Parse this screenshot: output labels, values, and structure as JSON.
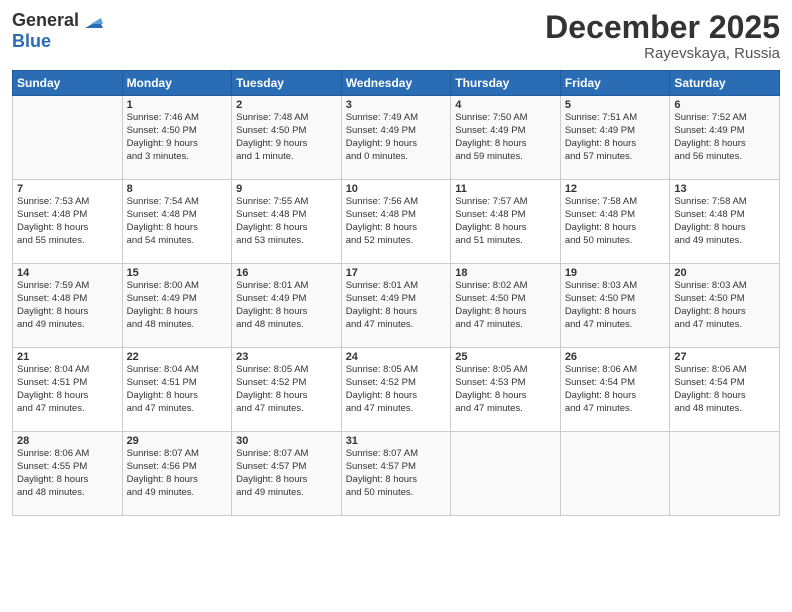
{
  "logo": {
    "general": "General",
    "blue": "Blue"
  },
  "title": "December 2025",
  "location": "Rayevskaya, Russia",
  "weekdays": [
    "Sunday",
    "Monday",
    "Tuesday",
    "Wednesday",
    "Thursday",
    "Friday",
    "Saturday"
  ],
  "weeks": [
    [
      {
        "day": "",
        "lines": []
      },
      {
        "day": "1",
        "lines": [
          "Sunrise: 7:46 AM",
          "Sunset: 4:50 PM",
          "Daylight: 9 hours",
          "and 3 minutes."
        ]
      },
      {
        "day": "2",
        "lines": [
          "Sunrise: 7:48 AM",
          "Sunset: 4:50 PM",
          "Daylight: 9 hours",
          "and 1 minute."
        ]
      },
      {
        "day": "3",
        "lines": [
          "Sunrise: 7:49 AM",
          "Sunset: 4:49 PM",
          "Daylight: 9 hours",
          "and 0 minutes."
        ]
      },
      {
        "day": "4",
        "lines": [
          "Sunrise: 7:50 AM",
          "Sunset: 4:49 PM",
          "Daylight: 8 hours",
          "and 59 minutes."
        ]
      },
      {
        "day": "5",
        "lines": [
          "Sunrise: 7:51 AM",
          "Sunset: 4:49 PM",
          "Daylight: 8 hours",
          "and 57 minutes."
        ]
      },
      {
        "day": "6",
        "lines": [
          "Sunrise: 7:52 AM",
          "Sunset: 4:49 PM",
          "Daylight: 8 hours",
          "and 56 minutes."
        ]
      }
    ],
    [
      {
        "day": "7",
        "lines": [
          "Sunrise: 7:53 AM",
          "Sunset: 4:48 PM",
          "Daylight: 8 hours",
          "and 55 minutes."
        ]
      },
      {
        "day": "8",
        "lines": [
          "Sunrise: 7:54 AM",
          "Sunset: 4:48 PM",
          "Daylight: 8 hours",
          "and 54 minutes."
        ]
      },
      {
        "day": "9",
        "lines": [
          "Sunrise: 7:55 AM",
          "Sunset: 4:48 PM",
          "Daylight: 8 hours",
          "and 53 minutes."
        ]
      },
      {
        "day": "10",
        "lines": [
          "Sunrise: 7:56 AM",
          "Sunset: 4:48 PM",
          "Daylight: 8 hours",
          "and 52 minutes."
        ]
      },
      {
        "day": "11",
        "lines": [
          "Sunrise: 7:57 AM",
          "Sunset: 4:48 PM",
          "Daylight: 8 hours",
          "and 51 minutes."
        ]
      },
      {
        "day": "12",
        "lines": [
          "Sunrise: 7:58 AM",
          "Sunset: 4:48 PM",
          "Daylight: 8 hours",
          "and 50 minutes."
        ]
      },
      {
        "day": "13",
        "lines": [
          "Sunrise: 7:58 AM",
          "Sunset: 4:48 PM",
          "Daylight: 8 hours",
          "and 49 minutes."
        ]
      }
    ],
    [
      {
        "day": "14",
        "lines": [
          "Sunrise: 7:59 AM",
          "Sunset: 4:48 PM",
          "Daylight: 8 hours",
          "and 49 minutes."
        ]
      },
      {
        "day": "15",
        "lines": [
          "Sunrise: 8:00 AM",
          "Sunset: 4:49 PM",
          "Daylight: 8 hours",
          "and 48 minutes."
        ]
      },
      {
        "day": "16",
        "lines": [
          "Sunrise: 8:01 AM",
          "Sunset: 4:49 PM",
          "Daylight: 8 hours",
          "and 48 minutes."
        ]
      },
      {
        "day": "17",
        "lines": [
          "Sunrise: 8:01 AM",
          "Sunset: 4:49 PM",
          "Daylight: 8 hours",
          "and 47 minutes."
        ]
      },
      {
        "day": "18",
        "lines": [
          "Sunrise: 8:02 AM",
          "Sunset: 4:50 PM",
          "Daylight: 8 hours",
          "and 47 minutes."
        ]
      },
      {
        "day": "19",
        "lines": [
          "Sunrise: 8:03 AM",
          "Sunset: 4:50 PM",
          "Daylight: 8 hours",
          "and 47 minutes."
        ]
      },
      {
        "day": "20",
        "lines": [
          "Sunrise: 8:03 AM",
          "Sunset: 4:50 PM",
          "Daylight: 8 hours",
          "and 47 minutes."
        ]
      }
    ],
    [
      {
        "day": "21",
        "lines": [
          "Sunrise: 8:04 AM",
          "Sunset: 4:51 PM",
          "Daylight: 8 hours",
          "and 47 minutes."
        ]
      },
      {
        "day": "22",
        "lines": [
          "Sunrise: 8:04 AM",
          "Sunset: 4:51 PM",
          "Daylight: 8 hours",
          "and 47 minutes."
        ]
      },
      {
        "day": "23",
        "lines": [
          "Sunrise: 8:05 AM",
          "Sunset: 4:52 PM",
          "Daylight: 8 hours",
          "and 47 minutes."
        ]
      },
      {
        "day": "24",
        "lines": [
          "Sunrise: 8:05 AM",
          "Sunset: 4:52 PM",
          "Daylight: 8 hours",
          "and 47 minutes."
        ]
      },
      {
        "day": "25",
        "lines": [
          "Sunrise: 8:05 AM",
          "Sunset: 4:53 PM",
          "Daylight: 8 hours",
          "and 47 minutes."
        ]
      },
      {
        "day": "26",
        "lines": [
          "Sunrise: 8:06 AM",
          "Sunset: 4:54 PM",
          "Daylight: 8 hours",
          "and 47 minutes."
        ]
      },
      {
        "day": "27",
        "lines": [
          "Sunrise: 8:06 AM",
          "Sunset: 4:54 PM",
          "Daylight: 8 hours",
          "and 48 minutes."
        ]
      }
    ],
    [
      {
        "day": "28",
        "lines": [
          "Sunrise: 8:06 AM",
          "Sunset: 4:55 PM",
          "Daylight: 8 hours",
          "and 48 minutes."
        ]
      },
      {
        "day": "29",
        "lines": [
          "Sunrise: 8:07 AM",
          "Sunset: 4:56 PM",
          "Daylight: 8 hours",
          "and 49 minutes."
        ]
      },
      {
        "day": "30",
        "lines": [
          "Sunrise: 8:07 AM",
          "Sunset: 4:57 PM",
          "Daylight: 8 hours",
          "and 49 minutes."
        ]
      },
      {
        "day": "31",
        "lines": [
          "Sunrise: 8:07 AM",
          "Sunset: 4:57 PM",
          "Daylight: 8 hours",
          "and 50 minutes."
        ]
      },
      {
        "day": "",
        "lines": []
      },
      {
        "day": "",
        "lines": []
      },
      {
        "day": "",
        "lines": []
      }
    ]
  ]
}
